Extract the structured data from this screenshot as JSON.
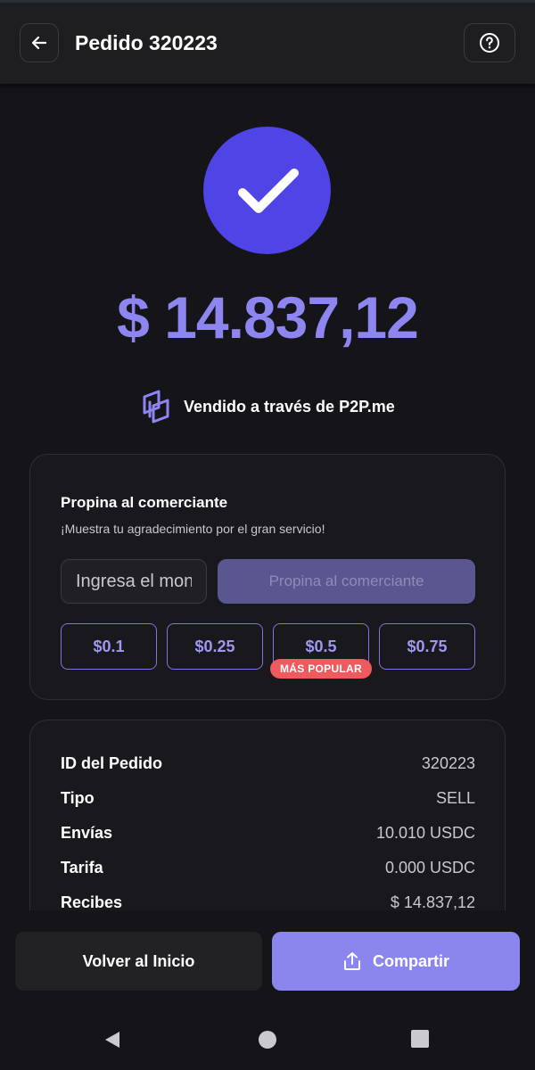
{
  "header": {
    "title": "Pedido 320223",
    "back_icon": "arrow-left-icon",
    "help_icon": "question-circle-icon"
  },
  "status": {
    "icon": "check-icon",
    "color": "#4f44e6"
  },
  "amount": "$ 14.837,12",
  "sold_via": {
    "text": "Vendido a través de P2P.me",
    "logo": "p2p-logo-icon"
  },
  "tip": {
    "title": "Propina al comerciante",
    "subtitle": "¡Muestra tu agradecimiento por el gran servicio!",
    "input_placeholder": "Ingresa el monto",
    "submit_label": "Propina al comerciante",
    "amounts": [
      "$0.1",
      "$0.25",
      "$0.5",
      "$0.75"
    ],
    "popular_badge": "MÁS POPULAR"
  },
  "details": [
    {
      "label": "ID del Pedido",
      "value": "320223"
    },
    {
      "label": "Tipo",
      "value": "SELL"
    },
    {
      "label": "Envías",
      "value": "10.010 USDC"
    },
    {
      "label": "Tarifa",
      "value": "0.000 USDC"
    },
    {
      "label": "Recibes",
      "value": "$ 14.837,12"
    }
  ],
  "actions": {
    "home_label": "Volver al Inicio",
    "share_label": "Compartir",
    "share_icon": "share-icon"
  },
  "colors": {
    "accent": "#8e86f0",
    "badge": "#ef5a5f",
    "background": "#141419"
  }
}
